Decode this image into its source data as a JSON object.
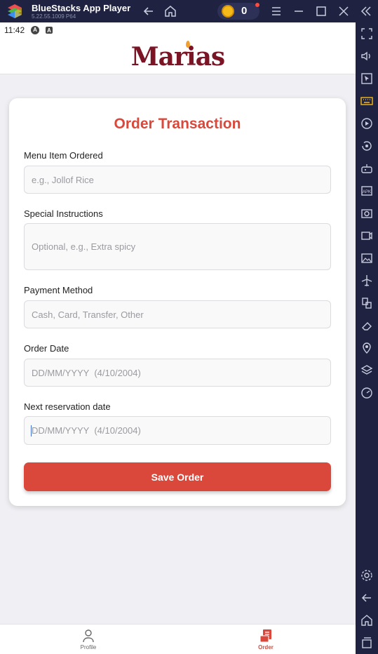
{
  "window": {
    "title": "BlueStacks App Player",
    "version": "5.22.55.1009  P64",
    "coin_count": "0"
  },
  "statusbar": {
    "time": "11:42",
    "badge1": "A",
    "badge2": "A"
  },
  "app": {
    "logo_text": "Marias"
  },
  "form": {
    "title": "Order Transaction",
    "menu_item": {
      "label": "Menu Item Ordered",
      "placeholder": "e.g., Jollof Rice",
      "value": ""
    },
    "special_instructions": {
      "label": "Special Instructions",
      "placeholder": "Optional, e.g., Extra spicy",
      "value": ""
    },
    "payment_method": {
      "label": "Payment Method",
      "placeholder": "Cash, Card, Transfer, Other",
      "value": ""
    },
    "order_date": {
      "label": "Order Date",
      "placeholder": "DD/MM/YYYY  (4/10/2004)",
      "value": ""
    },
    "next_reservation": {
      "label": "Next reservation date",
      "placeholder": "DD/MM/YYYY  (4/10/2004)",
      "value": ""
    },
    "save_label": "Save Order"
  },
  "bottom_nav": {
    "items": [
      {
        "label": "Profile",
        "icon": "person-icon",
        "active": false
      },
      {
        "label": "Order",
        "icon": "receipt-icon",
        "active": true
      }
    ],
    "active_color": "#d9483b",
    "inactive_color": "#666666"
  },
  "colors": {
    "accent": "#d9483b",
    "brand": "#7a1526",
    "chrome": "#1f2240"
  }
}
